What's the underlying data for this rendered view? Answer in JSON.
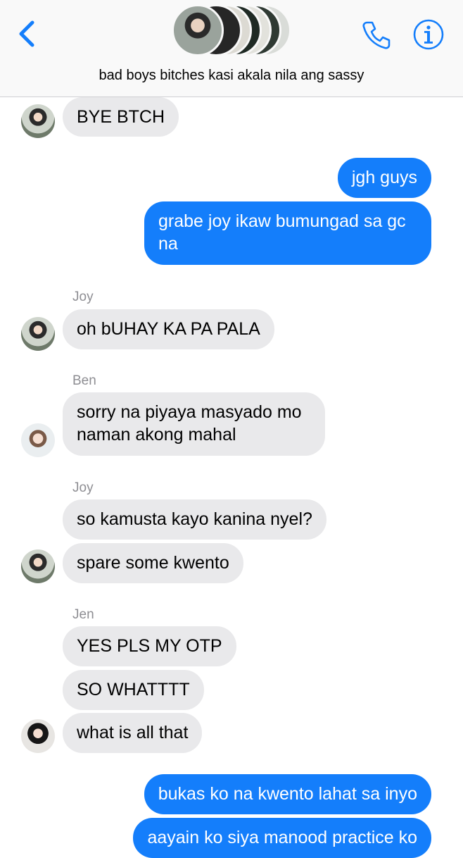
{
  "header": {
    "title": "bad boys bitches kasi akala nila ang sassy",
    "back_icon": "chevron-left-icon",
    "call_icon": "phone-icon",
    "info_icon": "info-icon",
    "accent_color": "#147efb"
  },
  "messages": [
    {
      "sender": "",
      "text": "BYE BTCH",
      "outgoing": false
    },
    {
      "sender": "",
      "text": "jgh guys",
      "outgoing": true
    },
    {
      "sender": "",
      "text": "grabe joy ikaw bumungad sa gc\nna",
      "outgoing": true
    },
    {
      "sender": "Joy",
      "text": "oh bUHAY KA PA PALA",
      "outgoing": false
    },
    {
      "sender": "Ben",
      "text": "sorry na piyaya masyado mo\nnaman akong mahal",
      "outgoing": false
    },
    {
      "sender": "Joy",
      "text": "so kamusta kayo kanina nyel?",
      "outgoing": false
    },
    {
      "sender": "",
      "text": "spare some kwento",
      "outgoing": false
    },
    {
      "sender": "Jen",
      "text": "YES PLS MY OTP",
      "outgoing": false
    },
    {
      "sender": "",
      "text": "SO WHATTTT",
      "outgoing": false
    },
    {
      "sender": "",
      "text": "what is all that",
      "outgoing": false
    },
    {
      "sender": "",
      "text": "bukas ko na kwento lahat sa inyo",
      "outgoing": true
    },
    {
      "sender": "",
      "text": "aayain ko siya manood practice ko",
      "outgoing": true
    }
  ]
}
